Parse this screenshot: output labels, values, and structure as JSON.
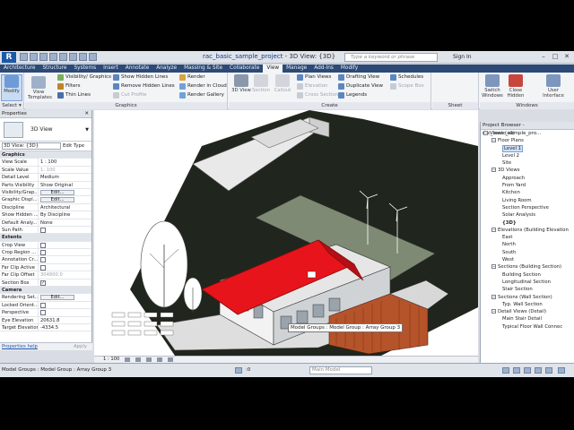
{
  "window": {
    "app_logo": "R",
    "file_name": "rac_basic_sample_project",
    "view_title": "3D View: {3D}",
    "search_placeholder": "Type a keyword or phrase",
    "sign_in": "Sign In",
    "controls": [
      "–",
      "□",
      "✕"
    ]
  },
  "tabs": [
    "Architecture",
    "Structure",
    "Systems",
    "Insert",
    "Annotate",
    "Analyze",
    "Massing & Site",
    "Collaborate",
    "View",
    "Manage",
    "Add-Ins",
    "Modify"
  ],
  "active_tab": "View",
  "ribbon": {
    "select": {
      "modify": "Modify",
      "panel": "Select ▾"
    },
    "graphics": {
      "view_templates": "View Templates",
      "visibility_graphics": "Visibility/ Graphics",
      "filters": "Filters",
      "thin_lines": "Thin Lines",
      "show_hidden_lines": "Show Hidden Lines",
      "remove_hidden_lines": "Remove Hidden Lines",
      "cut_profile": "Cut Profile",
      "render": "Render",
      "render_in_cloud": "Render in Cloud",
      "render_gallery": "Render Gallery",
      "panel": "Graphics"
    },
    "create": {
      "view_3d": "3D View",
      "section": "Section",
      "callout": "Callout",
      "plan_views": "Plan Views",
      "elevation": "Elevation",
      "cross_section": "Cross Section",
      "drafting_view": "Drafting View",
      "duplicate_view": "Duplicate View",
      "legends": "Legends",
      "schedules": "Schedules",
      "scope_box": "Scope Box",
      "panel": "Create"
    },
    "sheet": {
      "panel": "Sheet Composition"
    },
    "windows": {
      "switch_windows": "Switch Windows",
      "close_hidden": "Close Hidden",
      "user_interface": "User Interface",
      "panel": "Windows"
    }
  },
  "properties": {
    "header": "Properties",
    "type_name": "3D View",
    "instance_select": "3D View: {3D}",
    "edit_type": "Edit Type",
    "rows": [
      {
        "section": "Graphics"
      },
      {
        "k": "View Scale",
        "v": "1 : 100"
      },
      {
        "k": "Scale Value",
        "v": "1:  100",
        "gray": true
      },
      {
        "k": "Detail Level",
        "v": "Medium"
      },
      {
        "k": "Parts Visibility",
        "v": "Show Original"
      },
      {
        "k": "Visibility/Grap...",
        "btn": "Edit..."
      },
      {
        "k": "Graphic Displ...",
        "btn": "Edit..."
      },
      {
        "k": "Discipline",
        "v": "Architectural"
      },
      {
        "k": "Show Hidden ...",
        "v": "By Discipline"
      },
      {
        "k": "Default Analy...",
        "v": "None"
      },
      {
        "k": "Sun Path",
        "cb": false
      },
      {
        "section": "Extents"
      },
      {
        "k": "Crop View",
        "cb": false
      },
      {
        "k": "Crop Region ...",
        "cb": false
      },
      {
        "k": "Annotation Cr...",
        "cb": false
      },
      {
        "k": "Far Clip Active",
        "cb": false
      },
      {
        "k": "Far Clip Offset",
        "v": "304800.0",
        "gray": true
      },
      {
        "k": "Section Box",
        "cb": true
      },
      {
        "section": "Camera"
      },
      {
        "k": "Rendering Set...",
        "btn": "Edit..."
      },
      {
        "k": "Locked Orient...",
        "cb": false,
        "gray": true
      },
      {
        "k": "Perspective",
        "cb": false,
        "gray": true
      },
      {
        "k": "Eye Elevation",
        "v": "20631.8"
      },
      {
        "k": "Target Elevation",
        "v": "-4334.5"
      }
    ],
    "help": "Properties help",
    "apply": "Apply"
  },
  "view": {
    "scale": "1 : 100",
    "tooltip": "Model Groups : Model Group : Array Group 3"
  },
  "browser": {
    "header": "Project Browser - rac_basic_sample_pro...",
    "nodes": [
      {
        "t": "Views (all)",
        "d": 0,
        "tg": "−"
      },
      {
        "t": "Floor Plans",
        "d": 1,
        "tg": "−"
      },
      {
        "t": "Level 1",
        "d": 2,
        "sel": true
      },
      {
        "t": "Level 2",
        "d": 2
      },
      {
        "t": "Site",
        "d": 2
      },
      {
        "t": "3D Views",
        "d": 1,
        "tg": "−"
      },
      {
        "t": "Approach",
        "d": 2
      },
      {
        "t": "From Yard",
        "d": 2
      },
      {
        "t": "Kitchen",
        "d": 2
      },
      {
        "t": "Living Room",
        "d": 2
      },
      {
        "t": "Section Perspective",
        "d": 2
      },
      {
        "t": "Solar Analysis",
        "d": 2
      },
      {
        "t": "{3D}",
        "d": 2,
        "bold": true
      },
      {
        "t": "Elevations (Building Elevation",
        "d": 1,
        "tg": "−"
      },
      {
        "t": "East",
        "d": 2
      },
      {
        "t": "North",
        "d": 2
      },
      {
        "t": "South",
        "d": 2
      },
      {
        "t": "West",
        "d": 2
      },
      {
        "t": "Sections (Building Section)",
        "d": 1,
        "tg": "−"
      },
      {
        "t": "Building Section",
        "d": 2
      },
      {
        "t": "Longitudinal Section",
        "d": 2
      },
      {
        "t": "Stair Section",
        "d": 2
      },
      {
        "t": "Sections (Wall Section)",
        "d": 1,
        "tg": "−"
      },
      {
        "t": "Typ. Wall Section",
        "d": 2
      },
      {
        "t": "Detail Views (Detail)",
        "d": 1,
        "tg": "−"
      },
      {
        "t": "Main Stair Detail",
        "d": 2
      },
      {
        "t": "Typical Floor Wall Connec",
        "d": 2
      }
    ]
  },
  "status": {
    "message": "Model Groups : Model Group : Array Group 3",
    "model_dropdown": "Main Model",
    "zero": ":0"
  },
  "colors": {
    "roof": "#e8141b",
    "deck": "#b5532a",
    "ribbon_tab_bar": "#2d4a76",
    "selection": "#cfe0f7"
  }
}
